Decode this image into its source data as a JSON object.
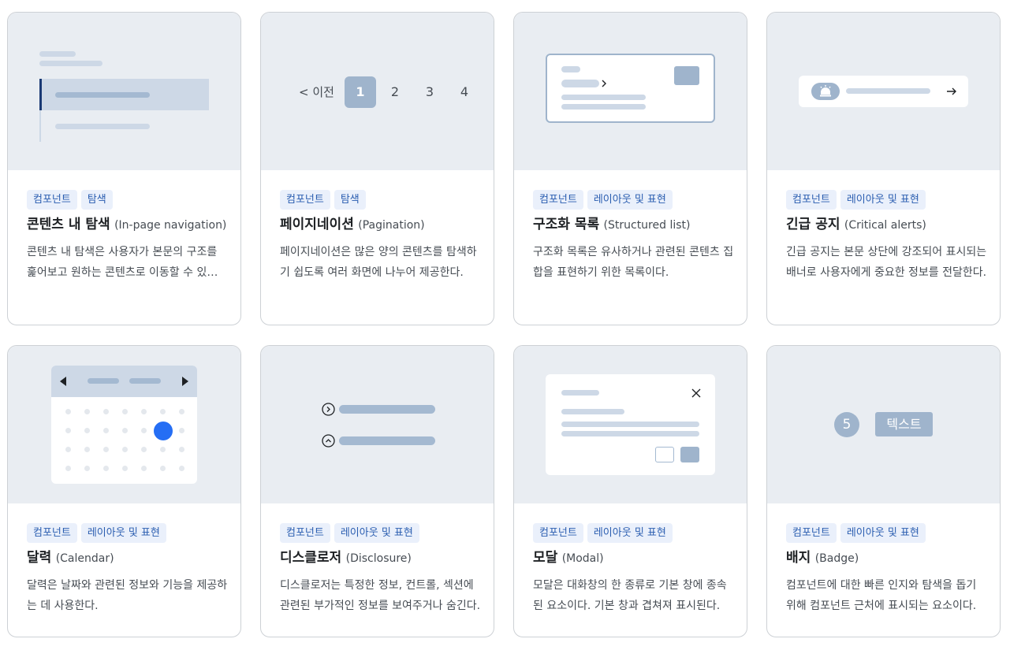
{
  "colors": {
    "tag_text": "#2a5db0",
    "tag_bg": "#eaf0fb",
    "thumb_bg": "#e9edf2",
    "accent_blue": "#256ef4",
    "muted_blue": "#9fb4cc"
  },
  "cards": [
    {
      "tags": [
        "컴포넌트",
        "탐색"
      ],
      "title_ko": "콘텐츠 내 탐색",
      "title_en": "(In-page navigation)",
      "desc": "콘텐츠 내 탐색은 사용자가 본문의 구조를 훑어보고 원하는 콘텐츠로 이동할 수 있도록 돕는다."
    },
    {
      "tags": [
        "컴포넌트",
        "탐색"
      ],
      "title_ko": "페이지네이션",
      "title_en": "(Pagination)",
      "desc": "페이지네이션은 많은 양의 콘텐츠를 탐색하기 쉽도록 여러 화면에 나누어 제공한다.",
      "thumb": {
        "prev_label": "< 이전",
        "pages": [
          "1",
          "2",
          "3",
          "4"
        ],
        "active_page": "1"
      }
    },
    {
      "tags": [
        "컴포넌트",
        "레이아웃 및 표현"
      ],
      "title_ko": "구조화 목록",
      "title_en": "(Structured list)",
      "desc": "구조화 목록은 유사하거나 관련된 콘텐츠 집합을 표현하기 위한 목록이다."
    },
    {
      "tags": [
        "컴포넌트",
        "레이아웃 및 표현"
      ],
      "title_ko": "긴급 공지",
      "title_en": "(Critical alerts)",
      "desc": "긴급 공지는 본문 상단에 강조되어 표시되는 배너로 사용자에게 중요한 정보를 전달한다."
    },
    {
      "tags": [
        "컴포넌트",
        "레이아웃 및 표현"
      ],
      "title_ko": "달력",
      "title_en": "(Calendar)",
      "desc": "달력은 날짜와 관련된 정보와 기능을 제공하는 데 사용한다."
    },
    {
      "tags": [
        "컴포넌트",
        "레이아웃 및 표현"
      ],
      "title_ko": "디스클로저",
      "title_en": "(Disclosure)",
      "desc": "디스클로저는 특정한 정보, 컨트롤, 섹션에 관련된 부가적인 정보를 보여주거나 숨긴다."
    },
    {
      "tags": [
        "컴포넌트",
        "레이아웃 및 표현"
      ],
      "title_ko": "모달",
      "title_en": "(Modal)",
      "desc": "모달은 대화창의 한 종류로 기본 창에 종속된 요소이다. 기본 창과 겹쳐져 표시된다."
    },
    {
      "tags": [
        "컴포넌트",
        "레이아웃 및 표현"
      ],
      "title_ko": "배지",
      "title_en": "(Badge)",
      "desc": "컴포넌트에 대한 빠른 인지와 탐색을 돕기 위해 컴포넌트 근처에 표시되는 요소이다.",
      "thumb": {
        "count": "5",
        "text": "텍스트"
      }
    }
  ],
  "icons": {
    "close": "close-icon",
    "arrow_right": "arrow-right-icon",
    "siren": "siren-icon",
    "chevron": "chevron-icon"
  }
}
